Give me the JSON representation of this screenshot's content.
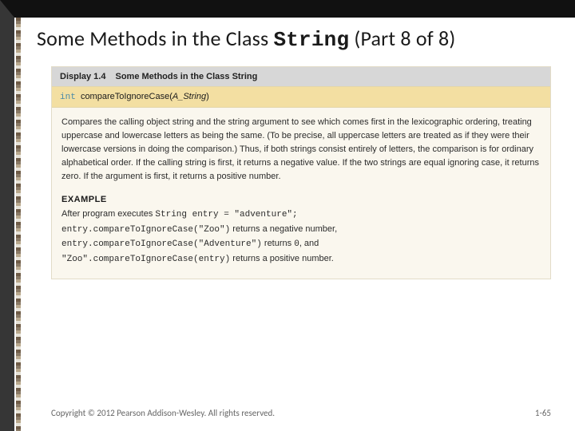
{
  "title_prefix": "Some Methods in the Class ",
  "title_class": "String",
  "title_suffix": " (Part 8 of 8)",
  "display_label": "Display 1.4",
  "display_title": "Some Methods in the Class String",
  "sig_keyword": "int",
  "sig_method": "compareToIgnoreCase(",
  "sig_arg": "A_String",
  "sig_close": ")",
  "description": "Compares the calling object string and the string argument to see which comes first in the lexicographic ordering, treating uppercase and lowercase letters as being the same. (To be precise, all uppercase letters are treated as if they were their lowercase versions in doing the comparison.) Thus, if both strings consist entirely of letters, the comparison is for ordinary alphabetical order. If the calling string is first, it returns a negative value. If the two strings are equal ignoring case, it returns zero. If the argument is first, it returns a positive number.",
  "example_label": "EXAMPLE",
  "example_intro": "After program executes ",
  "example_decl": "String entry = \"adventure\";",
  "example_line1_code": "entry.compareToIgnoreCase(\"Zoo\")",
  "example_line1_tail": " returns a negative number,",
  "example_line2_code": "entry.compareToIgnoreCase(\"Adventure\")",
  "example_line2_mid": " returns ",
  "example_line2_val": "0",
  "example_line2_tail": ", and",
  "example_line3_code": "\"Zoo\".compareToIgnoreCase(entry)",
  "example_line3_tail": " returns a positive number.",
  "copyright": "Copyright © 2012 Pearson Addison-Wesley. All rights reserved.",
  "page_number": "1-65"
}
